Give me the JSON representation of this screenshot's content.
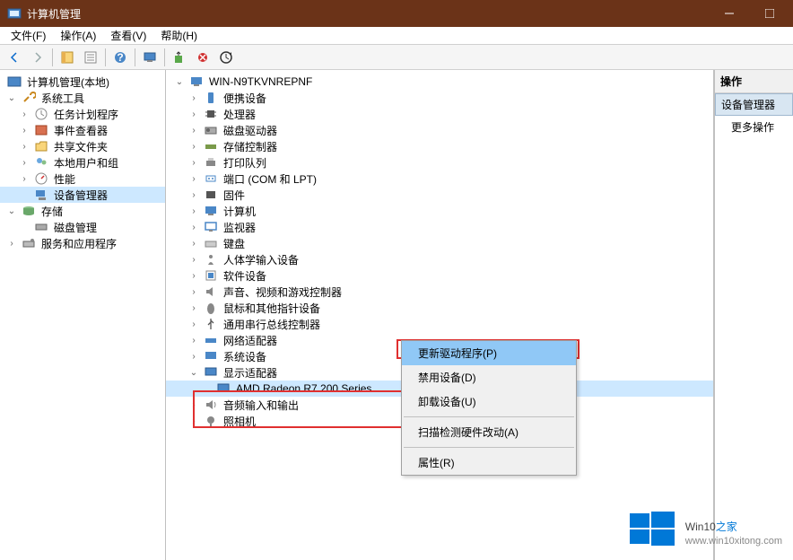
{
  "titlebar": {
    "title": "计算机管理"
  },
  "menubar": {
    "file": "文件(F)",
    "action": "操作(A)",
    "view": "查看(V)",
    "help": "帮助(H)"
  },
  "left_tree": {
    "root": "计算机管理(本地)",
    "sys_tools": "系统工具",
    "task_scheduler": "任务计划程序",
    "event_viewer": "事件查看器",
    "shared_folders": "共享文件夹",
    "local_users": "本地用户和组",
    "performance": "性能",
    "device_manager": "设备管理器",
    "storage": "存储",
    "disk_mgmt": "磁盘管理",
    "services": "服务和应用程序"
  },
  "mid_tree": {
    "root": "WIN-N9TKVNREPNF",
    "portable": "便携设备",
    "processor": "处理器",
    "disk_drive": "磁盘驱动器",
    "storage_ctrl": "存储控制器",
    "print_queue": "打印队列",
    "ports": "端口 (COM 和 LPT)",
    "firmware": "固件",
    "computer": "计算机",
    "monitor": "监视器",
    "keyboard": "键盘",
    "hid": "人体学输入设备",
    "software": "软件设备",
    "audio_game": "声音、视频和游戏控制器",
    "mouse": "鼠标和其他指针设备",
    "usb": "通用串行总线控制器",
    "network": "网络适配器",
    "system": "系统设备",
    "display": "显示适配器",
    "gpu": "AMD Radeon R7 200 Series",
    "audio_io": "音频输入和输出",
    "camera": "照相机"
  },
  "context_menu": {
    "update": "更新驱动程序(P)",
    "disable": "禁用设备(D)",
    "uninstall": "卸载设备(U)",
    "scan": "扫描检测硬件改动(A)",
    "properties": "属性(R)"
  },
  "right_pane": {
    "header": "操作",
    "section": "设备管理器",
    "more": "更多操作"
  },
  "watermark": {
    "brand": "Win10",
    "suffix": "之家",
    "url": "www.win10xitong.com"
  }
}
